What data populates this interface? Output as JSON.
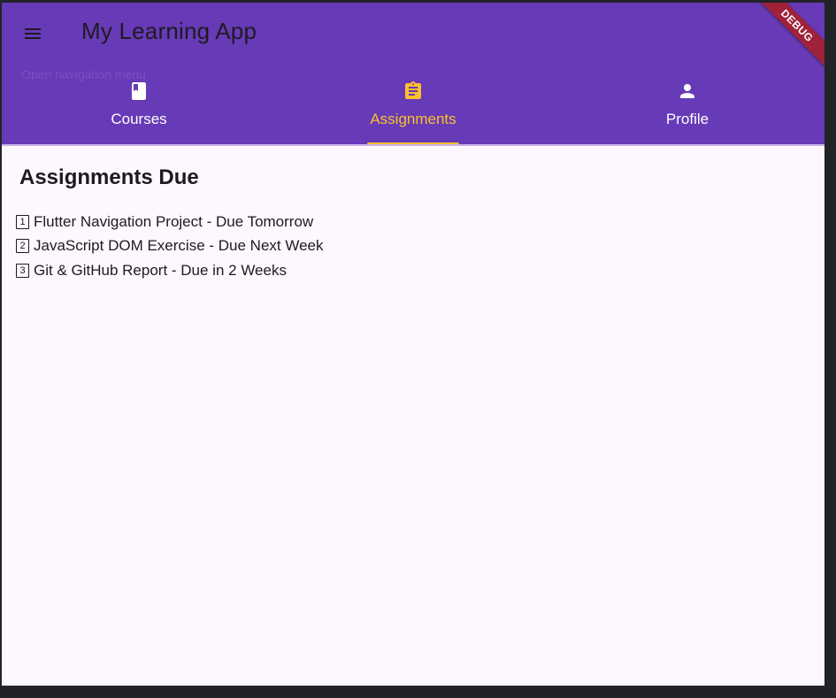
{
  "appbar": {
    "title": "My Learning App",
    "menu_tooltip": "Open navigation menu",
    "debug_banner": "DEBUG",
    "background": "#673ab7"
  },
  "tabs": [
    {
      "label": "Courses",
      "icon": "book-icon",
      "active": false
    },
    {
      "label": "Assignments",
      "icon": "assignment-icon",
      "active": true
    },
    {
      "label": "Profile",
      "icon": "person-icon",
      "active": false
    }
  ],
  "accent_color": "#fbc02d",
  "content": {
    "heading": "Assignments Due",
    "items": [
      {
        "number": "1",
        "text": "Flutter Navigation Project - Due Tomorrow"
      },
      {
        "number": "2",
        "text": "JavaScript DOM Exercise - Due Next Week"
      },
      {
        "number": "3",
        "text": "Git & GitHub Report - Due in 2 Weeks"
      }
    ]
  }
}
